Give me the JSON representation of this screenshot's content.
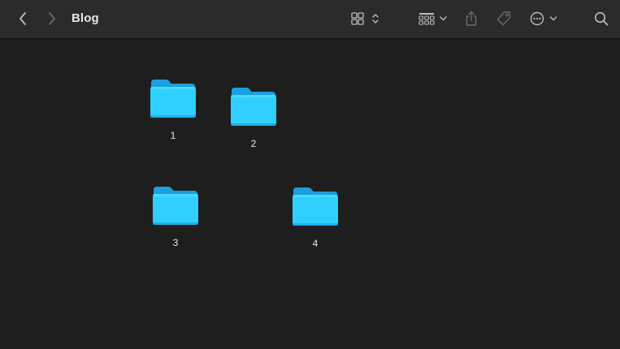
{
  "window": {
    "title": "Blog"
  },
  "toolbar": {
    "back_icon": "chevron-left-icon",
    "forward_icon": "chevron-right-icon",
    "view_icon": "icon-grid-icon",
    "group_icon": "group-grid-icon",
    "share_icon": "share-icon",
    "tag_icon": "tag-icon",
    "more_icon": "ellipsis-circle-icon",
    "search_icon": "search-icon"
  },
  "folders": [
    {
      "label": "1"
    },
    {
      "label": "2"
    },
    {
      "label": "3"
    },
    {
      "label": "4"
    }
  ],
  "colors": {
    "toolbar_bg": "#2b2b2b",
    "content_bg": "#1e1e1e",
    "folder_light": "#2fd0ff",
    "folder_dark": "#1a9fe0",
    "text": "#e6e6e6",
    "icon": "#bdbdbd",
    "icon_disabled": "#6a6a6a"
  }
}
